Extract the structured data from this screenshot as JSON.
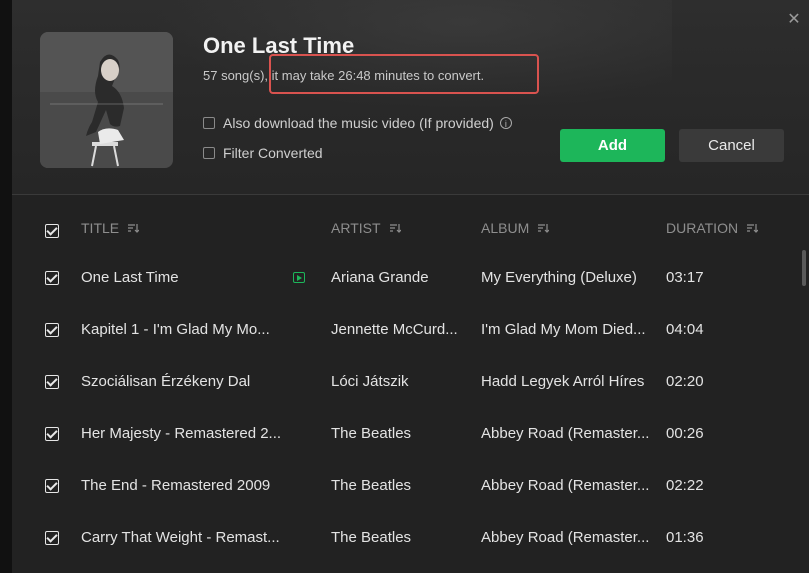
{
  "dialog": {
    "album_title": "One Last Time",
    "subtitle_count": "57 song(s),",
    "subtitle_time": " it may take 26:48 minutes to convert.",
    "option_video": "Also download the music video (If provided)",
    "option_filter": "Filter Converted",
    "add_label": "Add",
    "cancel_label": "Cancel",
    "close_glyph": "✕",
    "info_glyph": "i"
  },
  "columns": {
    "title": "TITLE",
    "artist": "ARTIST",
    "album": "ALBUM",
    "duration": "DURATION"
  },
  "rows": [
    {
      "title": "One Last Time",
      "artist": "Ariana Grande",
      "album": "My Everything (Deluxe)",
      "duration": "03:17",
      "video": true
    },
    {
      "title": "Kapitel 1 - I'm Glad My Mo...",
      "artist": "Jennette McCurd...",
      "album": "I'm Glad My Mom Died...",
      "duration": "04:04",
      "video": false
    },
    {
      "title": "Szociálisan Érzékeny Dal",
      "artist": "Lóci Játszik",
      "album": "Hadd Legyek Arról Híres",
      "duration": "02:20",
      "video": false
    },
    {
      "title": "Her Majesty - Remastered 2...",
      "artist": "The Beatles",
      "album": "Abbey Road (Remaster...",
      "duration": "00:26",
      "video": false
    },
    {
      "title": "The End - Remastered 2009",
      "artist": "The Beatles",
      "album": "Abbey Road (Remaster...",
      "duration": "02:22",
      "video": false
    },
    {
      "title": "Carry That Weight - Remast...",
      "artist": "The Beatles",
      "album": "Abbey Road (Remaster...",
      "duration": "01:36",
      "video": false
    }
  ],
  "colors": {
    "accent_green": "#1db65a",
    "highlight_red": "#d9534f"
  }
}
